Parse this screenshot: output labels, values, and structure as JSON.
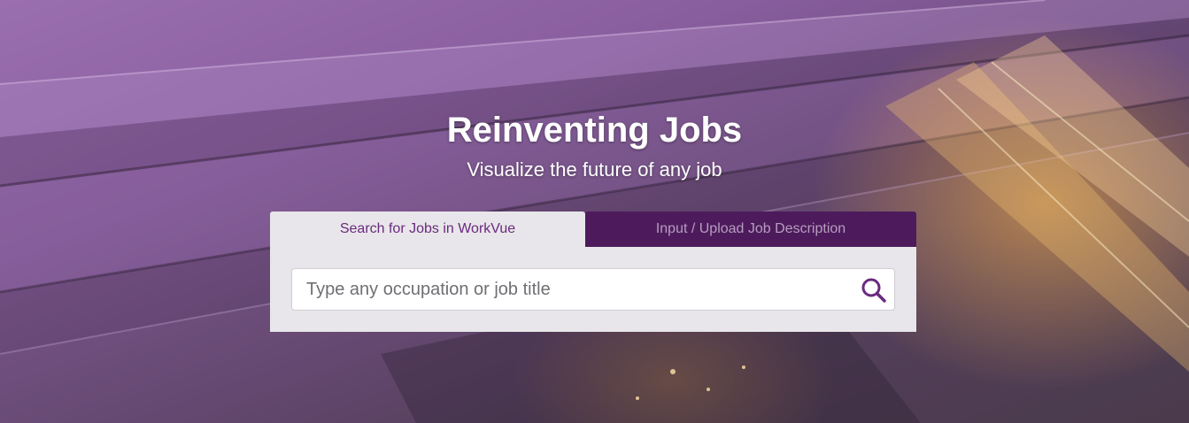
{
  "hero": {
    "title": "Reinventing Jobs",
    "subtitle": "Visualize the future of any job"
  },
  "tabs": [
    {
      "label": "Search for Jobs in WorkVue",
      "active": true
    },
    {
      "label": "Input / Upload Job Description",
      "active": false
    }
  ],
  "search": {
    "placeholder": "Type any occupation or job title",
    "value": "",
    "icon": "search-icon"
  },
  "colors": {
    "brand_purple": "#6a2a7e",
    "inactive_tab_bg": "#4d1b5c",
    "panel_bg": "#e8e6ea"
  }
}
